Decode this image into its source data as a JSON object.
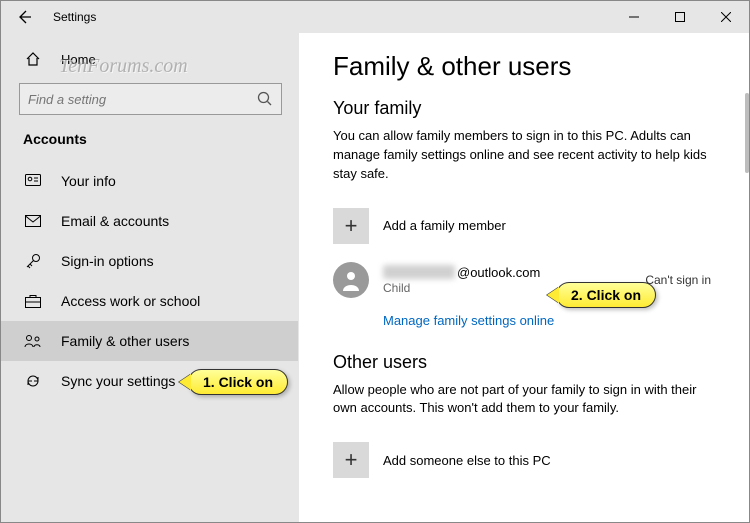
{
  "window": {
    "title": "Settings"
  },
  "sidebar": {
    "home": "Home",
    "search_placeholder": "Find a setting",
    "section": "Accounts",
    "items": [
      {
        "label": "Your info"
      },
      {
        "label": "Email & accounts"
      },
      {
        "label": "Sign-in options"
      },
      {
        "label": "Access work or school"
      },
      {
        "label": "Family & other users"
      },
      {
        "label": "Sync your settings"
      }
    ],
    "selected_index": 4
  },
  "content": {
    "title": "Family & other users",
    "family_heading": "Your family",
    "family_desc": "You can allow family members to sign in to this PC. Adults can manage family settings online and see recent activity to help kids stay safe.",
    "add_family": "Add a family member",
    "member": {
      "email_suffix": "@outlook.com",
      "role": "Child",
      "status": "Can't sign in"
    },
    "manage_link": "Manage family settings online",
    "other_heading": "Other users",
    "other_desc": "Allow people who are not part of your family to sign in with their own accounts. This won't add them to your family.",
    "add_other": "Add someone else to this PC"
  },
  "annotations": {
    "callout1": "1. Click on",
    "callout2": "2. Click on",
    "watermark": "TenForums.com"
  }
}
